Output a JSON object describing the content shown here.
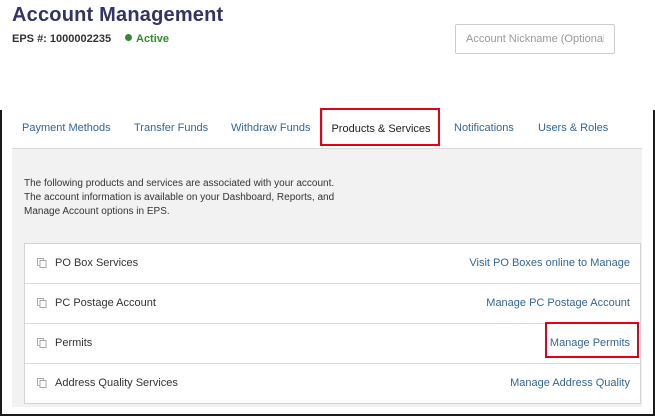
{
  "header": {
    "title": "Account Management",
    "eps_label": "EPS #: 1000002235",
    "status": "Active",
    "status_color": "#2e8b2e",
    "nickname_placeholder": "Account Nickname (Optional)"
  },
  "tabs": [
    {
      "label": "Payment Methods"
    },
    {
      "label": "Transfer Funds"
    },
    {
      "label": "Withdraw Funds"
    },
    {
      "label": "Products & Services",
      "active": true
    },
    {
      "label": "Notifications"
    },
    {
      "label": "Users & Roles"
    }
  ],
  "intro": "The following products and services are associated with your account. The account information is available on your Dashboard, Reports, and Manage Account options in EPS.",
  "services": [
    {
      "name": "PO Box Services",
      "action": "Visit PO Boxes online to Manage",
      "icon": "copy-icon"
    },
    {
      "name": "PC Postage Account",
      "action": "Manage PC Postage Account",
      "icon": "copy-icon"
    },
    {
      "name": "Permits",
      "action": "Manage Permits",
      "icon": "copy-icon"
    },
    {
      "name": "Address Quality Services",
      "action": "Manage Address Quality",
      "icon": "copy-icon"
    }
  ],
  "colors": {
    "title": "#333366",
    "link": "#336699",
    "highlight": "#e3001b",
    "content_bg": "#f2f2f2"
  }
}
